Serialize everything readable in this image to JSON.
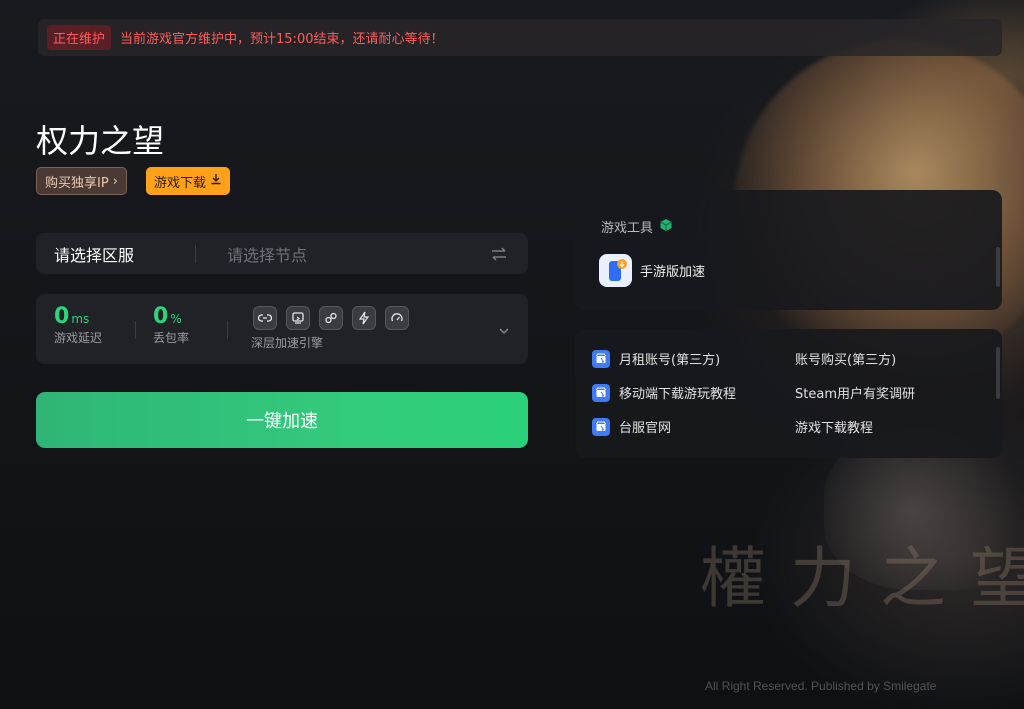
{
  "banner": {
    "tag": "正在维护",
    "message": "当前游戏官方维护中，预计15:00结束，还请耐心等待！"
  },
  "game": {
    "title": "权力之望",
    "buy_ip_label": "购买独享IP",
    "download_label": "游戏下载"
  },
  "selectors": {
    "server_label": "请选择区服",
    "node_placeholder": "请选择节点"
  },
  "stats": {
    "latency_value": "0",
    "latency_unit": "ms",
    "latency_label": "游戏延迟",
    "loss_value": "0",
    "loss_unit": "%",
    "loss_label": "丢包率",
    "engine_label": "深层加速引擎",
    "engine_icons": [
      "link-icon",
      "screen-icon",
      "nodes-icon",
      "bolt-icon",
      "speed-icon"
    ]
  },
  "accelerate_label": "一键加速",
  "tools": {
    "title": "游戏工具",
    "items": [
      {
        "label": "手游版加速",
        "icon": "mobile-icon"
      }
    ]
  },
  "links": [
    {
      "label": "月租账号(第三方)",
      "icon": "store-icon"
    },
    {
      "label": "账号购买(第三方)"
    },
    {
      "label": "移动端下载游玩教程",
      "icon": "store-icon"
    },
    {
      "label": "Steam用户有奖调研"
    },
    {
      "label": "台服官网",
      "icon": "store-icon"
    },
    {
      "label": "游戏下载教程"
    }
  ],
  "background": {
    "art_title": "權力之望",
    "copyright": "All Right Reserved. Published by Smilegate"
  },
  "colors": {
    "accent_green": "#2ed47a",
    "download_orange": "#ffa21a",
    "warning_red": "#ff5c5c"
  }
}
